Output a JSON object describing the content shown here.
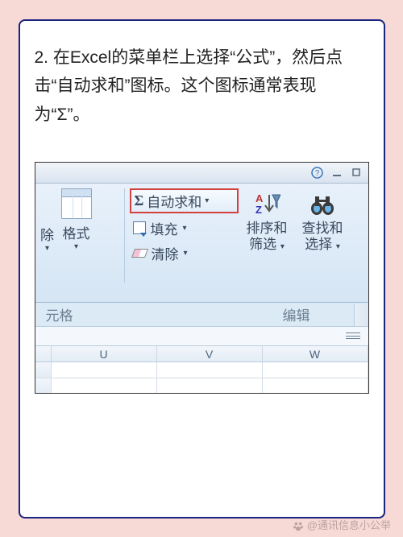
{
  "instruction": "2. 在Excel的菜单栏上选择“公式”，然后点击“自动求和”图标。这个图标通常表现为“Σ”。",
  "ribbon": {
    "delete_label": "除",
    "format_label": "格式",
    "autosum_label": "自动求和",
    "fill_label": "填充",
    "clear_label": "清除",
    "sort_filter_line1": "排序和",
    "sort_filter_line2": "筛选",
    "find_select_line1": "查找和",
    "find_select_line2": "选择"
  },
  "groups": {
    "cells_label": "元格",
    "editing_label": "编辑"
  },
  "columns": [
    "U",
    "V",
    "W"
  ],
  "watermark": "@通讯信息小公举"
}
